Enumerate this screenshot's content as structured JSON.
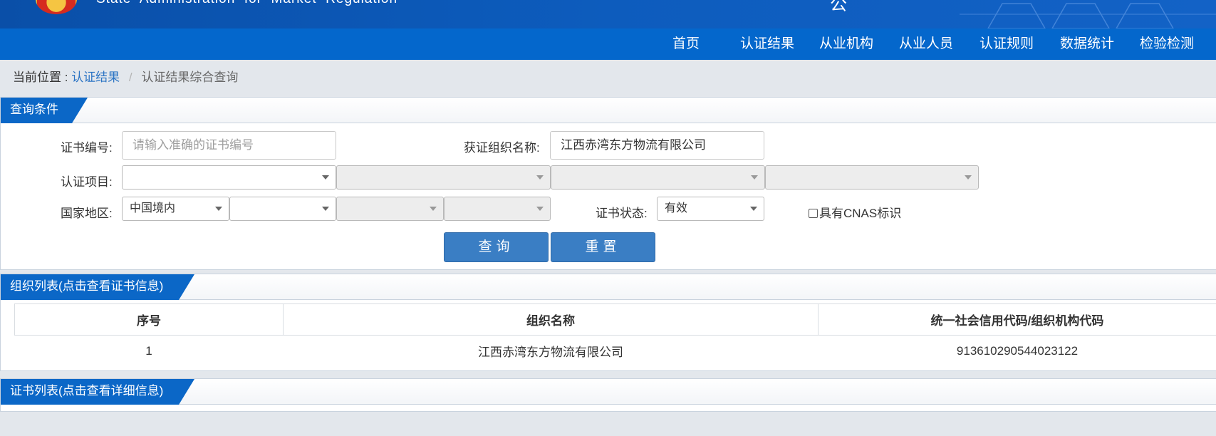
{
  "header": {
    "en_name": "State  Administration  for  Market  Regulation",
    "cn_fragment": "公"
  },
  "nav": {
    "items": [
      "首页",
      "认证结果",
      "从业机构",
      "从业人员",
      "认证规则",
      "数据统计",
      "检验检测"
    ]
  },
  "breadcrumb": {
    "prefix": "当前位置 :",
    "link": "认证结果",
    "separator": "/",
    "current": "认证结果综合查询"
  },
  "query_panel": {
    "title": "查询条件",
    "cert_no_label": "证书编号:",
    "cert_no_placeholder": "请输入准确的证书编号",
    "org_name_label": "获证组织名称:",
    "org_name_value": "江西赤湾东方物流有限公司",
    "project_label": "认证项目:",
    "region_label": "国家地区:",
    "region_value": "中国境内",
    "status_label": "证书状态:",
    "status_value": "有效",
    "cnas_label": "具有CNAS标识",
    "search_button": "查询",
    "reset_button": "重置"
  },
  "org_panel": {
    "title": "组织列表(点击查看证书信息)",
    "columns": [
      "序号",
      "组织名称",
      "统一社会信用代码/组织机构代码"
    ],
    "rows": [
      [
        "1",
        "江西赤湾东方物流有限公司",
        "913610290544023122"
      ]
    ]
  },
  "cert_panel": {
    "title": "证书列表(点击查看详细信息)"
  }
}
